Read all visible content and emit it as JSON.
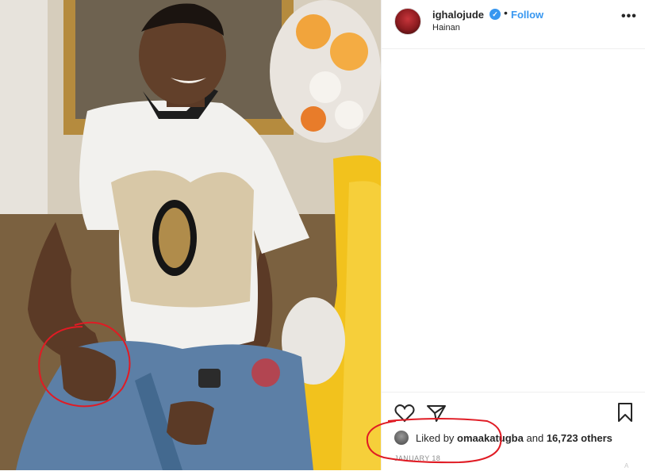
{
  "post": {
    "username": "ighalojude",
    "verified_glyph": "✓",
    "separator": "•",
    "follow_label": "Follow",
    "location": "Hainan",
    "more_glyph": "•••"
  },
  "actions": {
    "like_icon": "heart-icon",
    "share_icon": "paper-plane-icon",
    "save_icon": "bookmark-icon"
  },
  "likes": {
    "prefix": "Liked by",
    "user": "omaakatugba",
    "middle": "and",
    "others": "16,723 others"
  },
  "date": "JANUARY 18",
  "corner_text": "A",
  "colors": {
    "link_blue": "#3897f0",
    "text": "#262626",
    "muted": "#8e8e8e",
    "annotation_red": "#e01b24"
  }
}
